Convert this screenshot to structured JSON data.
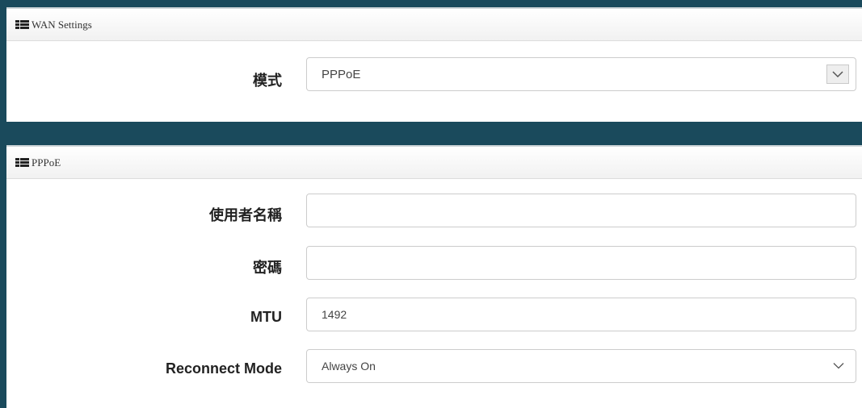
{
  "wan": {
    "title": "WAN Settings",
    "mode_label": "模式",
    "mode_value": "PPPoE"
  },
  "pppoe": {
    "title": "PPPoE",
    "username_label": "使用者名稱",
    "username_value": "",
    "password_label": "密碼",
    "password_value": "",
    "mtu_label": "MTU",
    "mtu_value": "1492",
    "reconnect_label": "Reconnect Mode",
    "reconnect_value": "Always On"
  }
}
